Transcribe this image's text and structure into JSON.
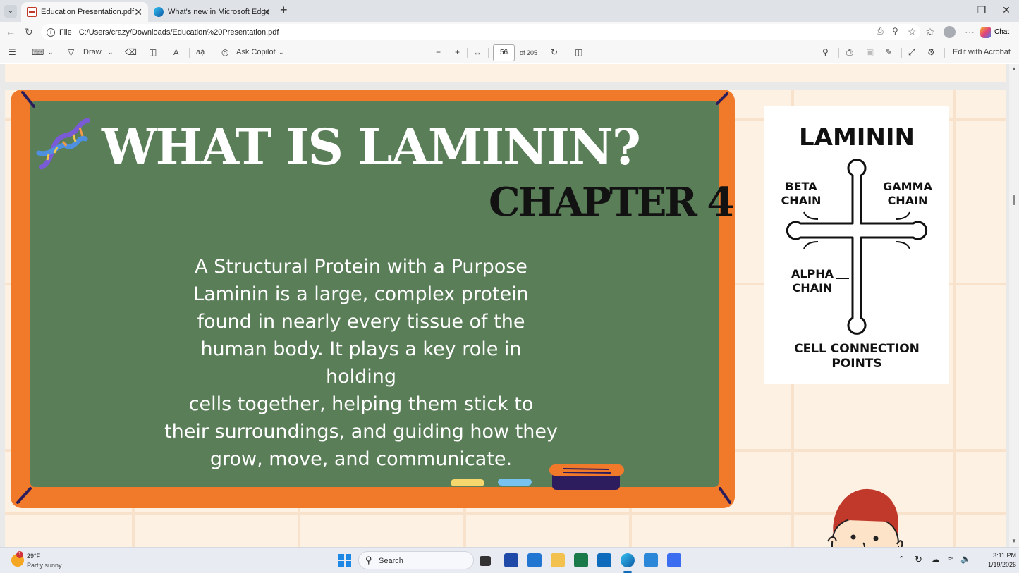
{
  "browser": {
    "tabs": [
      {
        "title": "Education Presentation.pdf",
        "active": true
      },
      {
        "title": "What's new in Microsoft Edge",
        "active": false
      }
    ],
    "address": {
      "scheme": "File",
      "url": "C:/Users/crazy/Downloads/Education%20Presentation.pdf"
    },
    "chat_label": "Chat"
  },
  "pdf_toolbar": {
    "draw_label": "Draw",
    "copilot_label": "Ask Copilot",
    "page_current": "56",
    "page_total": "of 205",
    "acrobat_label": "Edit with Acrobat"
  },
  "slide": {
    "title": "WHAT IS LAMININ?",
    "subtitle": "CHAPTER 4",
    "body_lines": [
      "A Structural Protein with a Purpose",
      "Laminin is a large, complex protein",
      "found in nearly every tissue of the",
      "human body. It plays a key role in holding",
      "cells together, helping them stick to",
      "their surroundings, and guiding how they",
      "grow, move, and communicate."
    ],
    "colors": {
      "board": "#5a7e58",
      "frame": "#f07a2a",
      "background": "#fdf1e4"
    }
  },
  "diagram": {
    "title": "LAMININ",
    "beta_line1": "BETA",
    "beta_line2": "CHAIN",
    "gamma_line1": "GAMMA",
    "gamma_line2": "CHAIN",
    "alpha_line1": "ALPHA",
    "alpha_line2": "CHAIN",
    "bottom_line1": "CELL CONNECTION",
    "bottom_line2": "POINTS"
  },
  "taskbar": {
    "weather_temp": "29°F",
    "weather_desc": "Partly sunny",
    "weather_badge": "1",
    "search_placeholder": "Search",
    "time": "3:11 PM",
    "date": "1/19/2026"
  }
}
